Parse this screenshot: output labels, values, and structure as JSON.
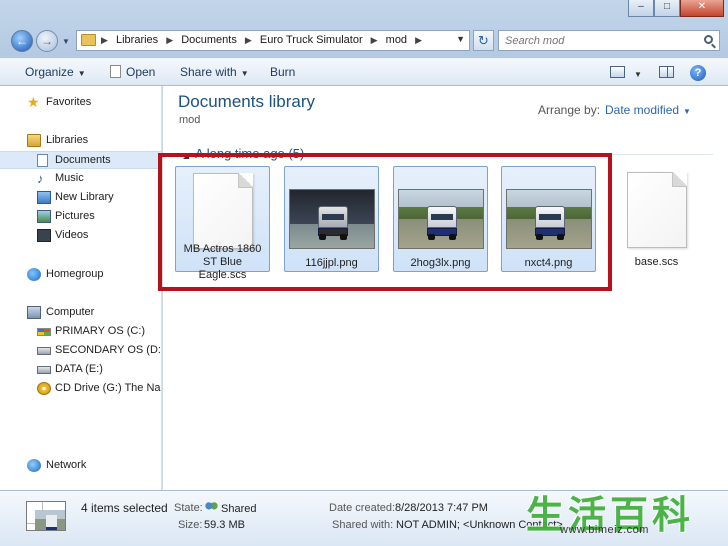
{
  "address": {
    "crumbs": [
      "Libraries",
      "Documents",
      "Euro Truck Simulator",
      "mod"
    ]
  },
  "search": {
    "placeholder": "Search mod"
  },
  "toolbar": {
    "organize": "Organize",
    "open": "Open",
    "share_with": "Share with",
    "burn": "Burn"
  },
  "nav": {
    "favorites": "Favorites",
    "libraries": "Libraries",
    "documents": "Documents",
    "music": "Music",
    "new_library": "New Library",
    "pictures": "Pictures",
    "videos": "Videos",
    "homegroup": "Homegroup",
    "computer": "Computer",
    "drive_c": "PRIMARY OS (C:)",
    "drive_d": "SECONDARY OS (D:)",
    "drive_e": "DATA (E:)",
    "drive_g": "CD Drive (G:) The Nan",
    "network": "Network"
  },
  "content": {
    "title": "Documents library",
    "subtitle": "mod",
    "arrange_label": "Arrange by:",
    "arrange_value": "Date modified",
    "group_label": "A long time ago (5)",
    "files": [
      {
        "name_line1": "MB Actros 1860",
        "name_line2": "ST Blue Eagle.scs"
      },
      {
        "name": "116jjpl.png"
      },
      {
        "name": "2hog3lx.png"
      },
      {
        "name": "nxct4.png"
      },
      {
        "name": "base.scs"
      }
    ]
  },
  "details": {
    "selection": "4 items selected",
    "state_label": "State:",
    "state_value": "Shared",
    "size_label": "Size:",
    "size_value": "59.3 MB",
    "date_label": "Date created:",
    "date_value": "8/28/2013 7:47 PM",
    "shared_label": "Shared with:",
    "shared_value": "NOT ADMIN; <Unknown Contact>"
  },
  "watermark": {
    "glyphs": "生活百科",
    "url": "www.bimeiz.com"
  },
  "colors": {
    "highlight_frame": "#b5121b",
    "library_title": "#1c5180",
    "link_blue": "#2a66b0",
    "selection_fill": "#cfe2f8"
  },
  "icons": {
    "back": "arrow-left-icon",
    "forward": "arrow-right-icon",
    "refresh": "refresh-icon",
    "search": "search-icon",
    "help": "help-icon"
  }
}
